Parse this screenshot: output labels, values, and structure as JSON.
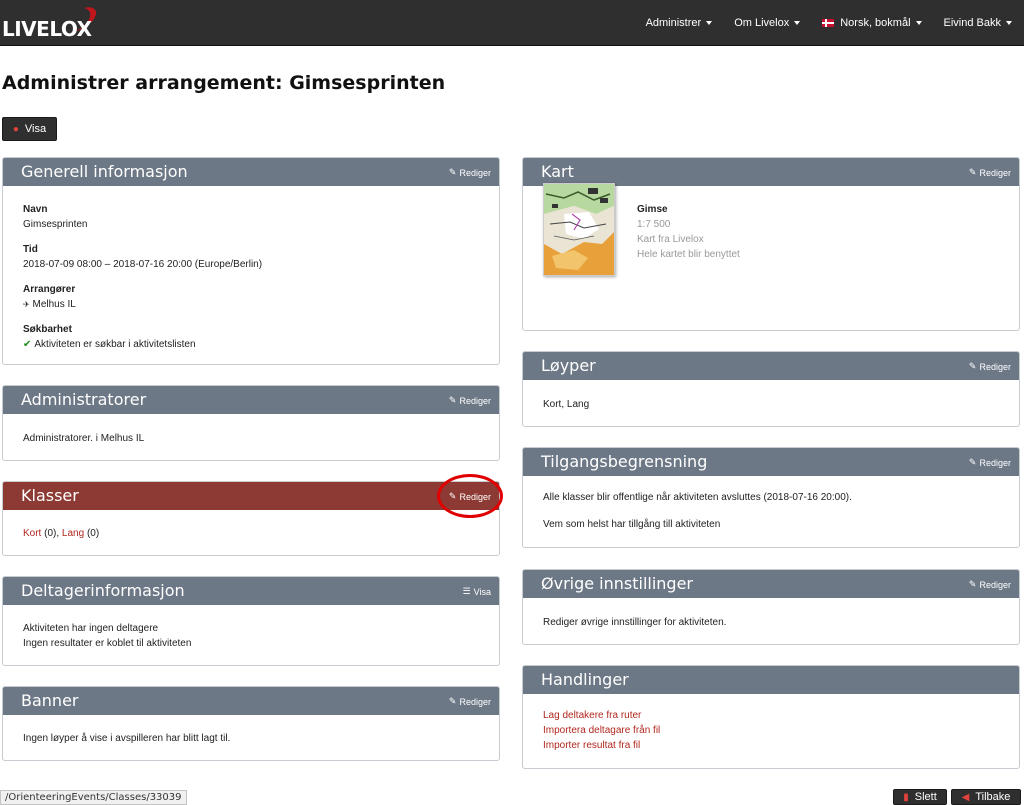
{
  "navbar": {
    "logo_text": "LIVELOX",
    "items": [
      {
        "label": "Administrer"
      },
      {
        "label": "Om Livelox"
      },
      {
        "label": "Norsk, bokmål"
      },
      {
        "label": "Eivind Bakk"
      }
    ]
  },
  "page": {
    "title": "Administrer arrangement: Gimsesprinten",
    "view_button": "Visa"
  },
  "panels": {
    "general": {
      "title": "Generell informasjon",
      "action": "Rediger",
      "name_label": "Navn",
      "name_value": "Gimsesprinten",
      "time_label": "Tid",
      "time_value": "2018-07-09 08:00 – 2018-07-16 20:00 (Europe/Berlin)",
      "organizers_label": "Arrangører",
      "organizers_value": "Melhus IL",
      "search_label": "Søkbarhet",
      "search_value": "Aktiviteten er søkbar i aktivitetslisten"
    },
    "admins": {
      "title": "Administratorer",
      "action": "Rediger",
      "text": "Administratorer. i Melhus IL"
    },
    "classes": {
      "title": "Klasser",
      "action": "Rediger",
      "class1_name": "Kort",
      "class1_count": "(0),",
      "class2_name": "Lang",
      "class2_count": "(0)"
    },
    "participants": {
      "title": "Deltagerinformasjon",
      "action": "Visa",
      "line1": "Aktiviteten har ingen deltagere",
      "line2": "Ingen resultater er koblet til aktiviteten"
    },
    "banner": {
      "title": "Banner",
      "action": "Rediger",
      "text": "Ingen løyper å vise i avspilleren har blitt lagt til."
    },
    "map": {
      "title": "Kart",
      "action": "Rediger",
      "map_name": "Gimse",
      "scale": "1:7 500",
      "source": "Kart fra Livelox",
      "usage": "Hele kartet blir benyttet"
    },
    "courses": {
      "title": "Løyper",
      "action": "Rediger",
      "text": "Kort, Lang"
    },
    "access": {
      "title": "Tilgangsbegrensning",
      "action": "Rediger",
      "line1": "Alle klasser blir offentlige når aktiviteten avsluttes (2018-07-16 20:00).",
      "line2": "Vem som helst har tillgång till aktiviteten"
    },
    "other": {
      "title": "Øvrige innstillinger",
      "action": "Rediger",
      "text": "Rediger øvrige innstillinger for aktiviteten."
    },
    "actions": {
      "title": "Handlinger",
      "link1": "Lag deltakere fra ruter",
      "link2": "Importera deltagare från fil",
      "link3": "Importer resultat fra fil"
    }
  },
  "footer": {
    "delete_button": "Slett",
    "back_button": "Tilbake"
  },
  "status_bar": {
    "url": "/OrienteeringEvents/Classes/33039"
  },
  "colors": {
    "navbar": "#2f2f2f",
    "panel_header": "#6d7886",
    "panel_header_active": "#8c3a33",
    "link": "#b1271f"
  }
}
